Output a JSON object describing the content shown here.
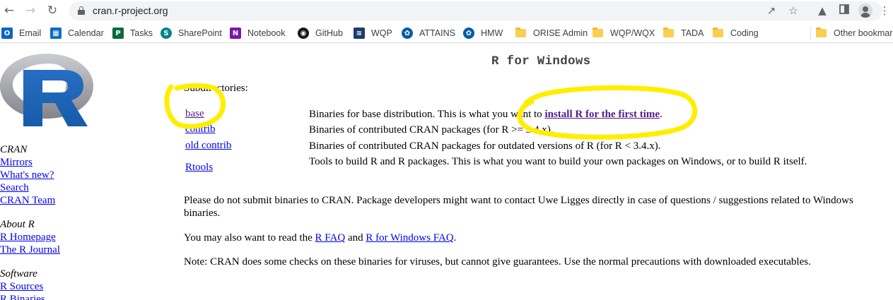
{
  "browser": {
    "url": "cran.r-project.org",
    "bookmarks": [
      {
        "label": "Email",
        "icon": "outlook-icon"
      },
      {
        "label": "Calendar",
        "icon": "calendar-icon"
      },
      {
        "label": "Tasks",
        "icon": "planner-icon"
      },
      {
        "label": "SharePoint",
        "icon": "sharepoint-icon"
      },
      {
        "label": "Notebook",
        "icon": "onenote-icon"
      },
      {
        "label": "GitHub",
        "icon": "github-icon"
      },
      {
        "label": "WQP",
        "icon": "wqp-icon"
      },
      {
        "label": "ATTAINS",
        "icon": "epa-icon"
      },
      {
        "label": "HMW",
        "icon": "epa-icon"
      },
      {
        "label": "ORISE Admin",
        "icon": "folder-icon"
      },
      {
        "label": "WQP/WQX",
        "icon": "folder-icon"
      },
      {
        "label": "TADA",
        "icon": "folder-icon"
      },
      {
        "label": "Coding",
        "icon": "folder-icon"
      },
      {
        "label": "Other bookmarks",
        "icon": "folder-icon"
      }
    ]
  },
  "sidebar": {
    "sections": [
      {
        "heading": "CRAN",
        "links": [
          "Mirrors",
          "What's new?",
          "Search",
          "CRAN Team"
        ]
      },
      {
        "heading": "About R",
        "links": [
          "R Homepage",
          "The R Journal"
        ]
      },
      {
        "heading": "Software",
        "links": [
          "R Sources",
          "R Binaries"
        ]
      }
    ]
  },
  "page": {
    "title": "R for Windows",
    "subdirectories_label": "Subdirectories:",
    "subdirectories": [
      {
        "name": "base",
        "desc_pre": "Binaries for base distribution. This is what you want to ",
        "desc_link": "install R for the first time",
        "desc_post": "."
      },
      {
        "name": "contrib",
        "desc": "Binaries of contributed CRAN packages (for R >= 3.4.x)."
      },
      {
        "name": "old contrib",
        "desc": "Binaries of contributed CRAN packages for outdated versions of R (for R < 3.4.x)."
      },
      {
        "name": "Rtools",
        "desc": "Tools to build R and R packages. This is what you want to build your own packages on Windows, or to build R itself."
      }
    ],
    "para1": "Please do not submit binaries to CRAN. Package developers might want to contact Uwe Ligges directly in case of questions / suggestions related to Windows binaries.",
    "para2_pre": "You may also want to read the ",
    "para2_link1": "R FAQ",
    "para2_mid": " and ",
    "para2_link2": "R for Windows FAQ",
    "para2_post": ".",
    "para3": "Note: CRAN does some checks on these binaries for viruses, but cannot give guarantees. Use the normal precautions with downloaded executables."
  },
  "annotation_color": "#ffee00"
}
